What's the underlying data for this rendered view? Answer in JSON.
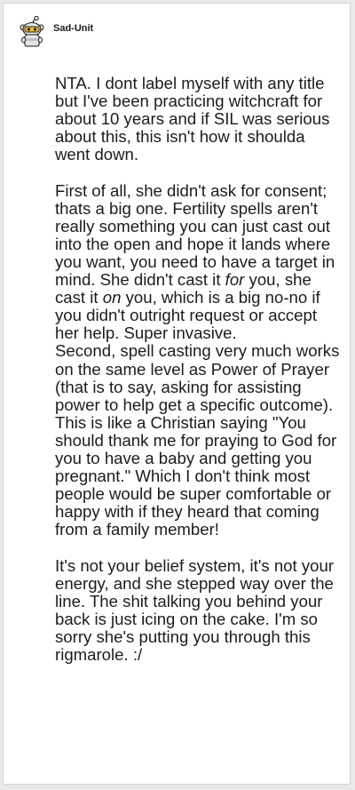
{
  "comment": {
    "author": "Sad-Unit",
    "paragraphs": [
      [
        {
          "text": "NTA. I dont label myself with any title but I've been practicing witchcraft for about 10 years and if SIL was serious about this, this isn't how it shoulda went down."
        }
      ],
      [
        {
          "text": "First of all, she didn't ask for consent; thats a big one. Fertility spells aren't really something you can just cast out into the open and hope it lands where you want, you need to have a target in mind. She didn't cast it "
        },
        {
          "text": "for",
          "em": true
        },
        {
          "text": " you, she cast it "
        },
        {
          "text": "on",
          "em": true
        },
        {
          "text": " you, which is a big no-no if you didn't outright request or accept her help. Super invasive."
        }
      ],
      [
        {
          "text": "Second, spell casting very much works on the same level as Power of Prayer (that is to say, asking for assisting power to help get a specific outcome). This is like a Christian saying \"You should thank me for praying to God for you to have a baby and getting you pregnant.\" Which I don't think most people would be super comfortable or happy with if they heard that coming from a family member!"
        }
      ],
      [
        {
          "text": "It's not your belief system, it's not your energy, and she stepped way over the line. The shit talking you behind your back is just icing on the cake. I'm so sorry she's putting you through this rigmarole. :/"
        }
      ]
    ],
    "gap_after": [
      true,
      false,
      true,
      false
    ]
  },
  "icons": {
    "avatar": "snoo-avatar-icon"
  },
  "colors": {
    "text": "#1c1c1c",
    "background": "#e9e9e9",
    "card": "#ffffff",
    "avatar_body": "#e6e6e6",
    "avatar_accent": "#f2c318"
  }
}
